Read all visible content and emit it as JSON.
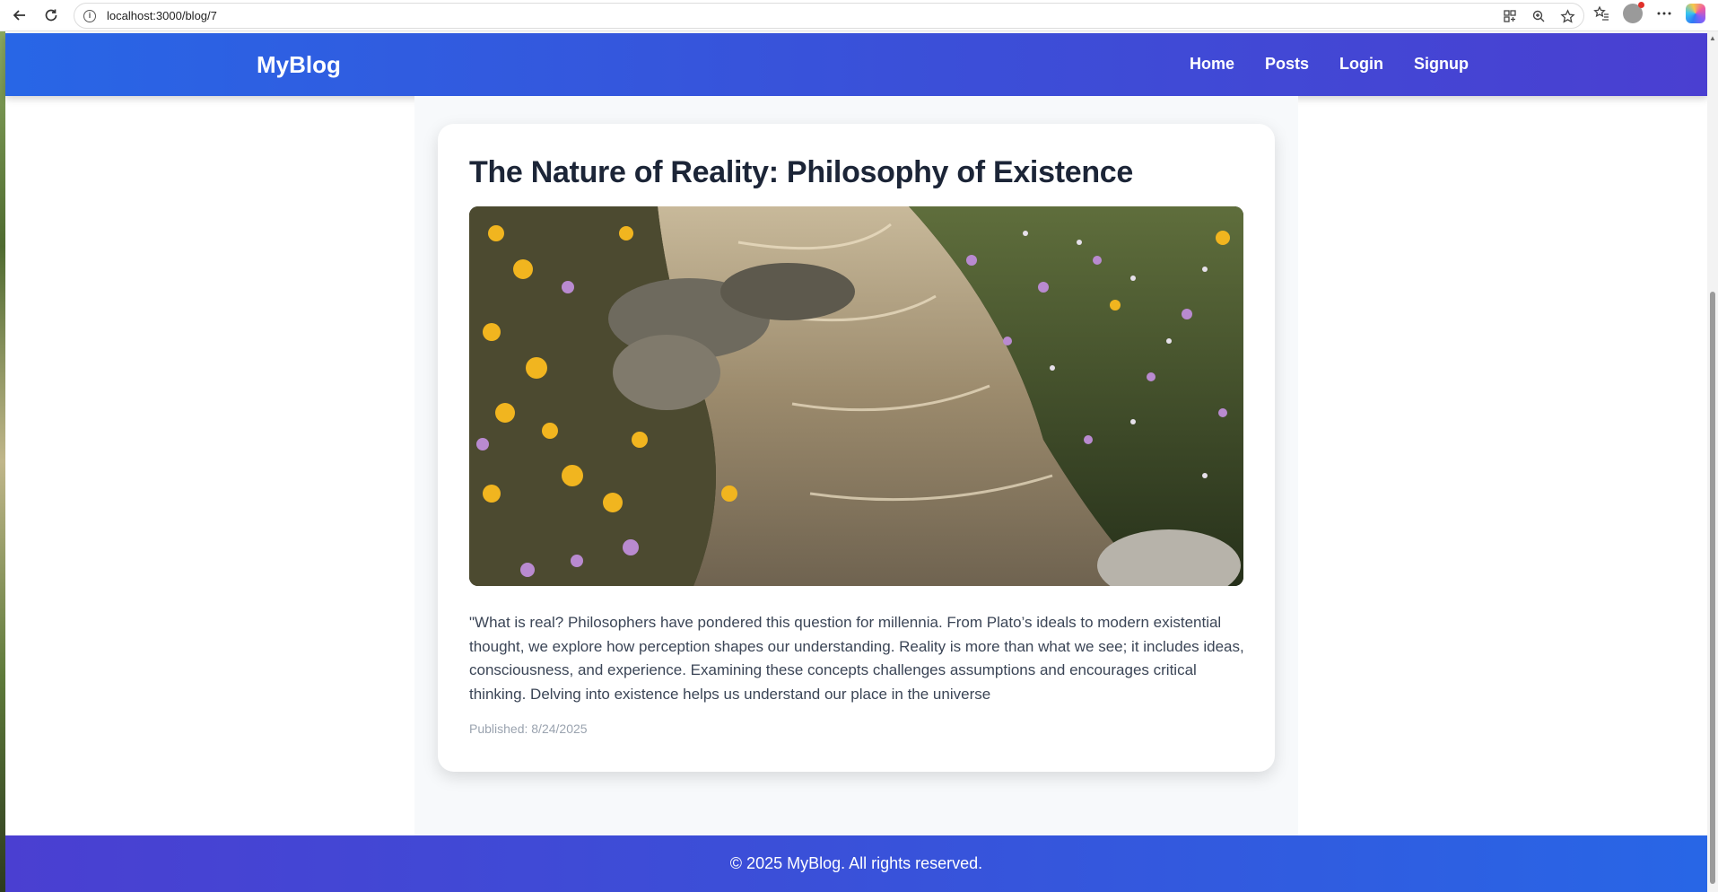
{
  "browser": {
    "url": "localhost:3000/blog/7"
  },
  "site": {
    "logo": "MyBlog",
    "nav": [
      "Home",
      "Posts",
      "Login",
      "Signup"
    ]
  },
  "post": {
    "title": "The Nature of Reality: Philosophy of Existence",
    "image_alt": "stream with rocks and wildflowers",
    "body": "\"What is real? Philosophers have pondered this question for millennia. From Plato’s ideals to modern existential thought, we explore how perception shapes our understanding. Reality is more than what we see; it includes ideas, consciousness, and experience. Examining these concepts challenges assumptions and encourages critical thinking. Delving into existence helps us understand our place in the universe",
    "published": "Published: 8/24/2025"
  },
  "footer": {
    "text": "© 2025 MyBlog. All rights reserved."
  },
  "colors": {
    "header_start": "#2866e6",
    "header_end": "#4a3fd1",
    "title": "#1c2537",
    "body": "#3b4556",
    "muted": "#9aa3af"
  }
}
